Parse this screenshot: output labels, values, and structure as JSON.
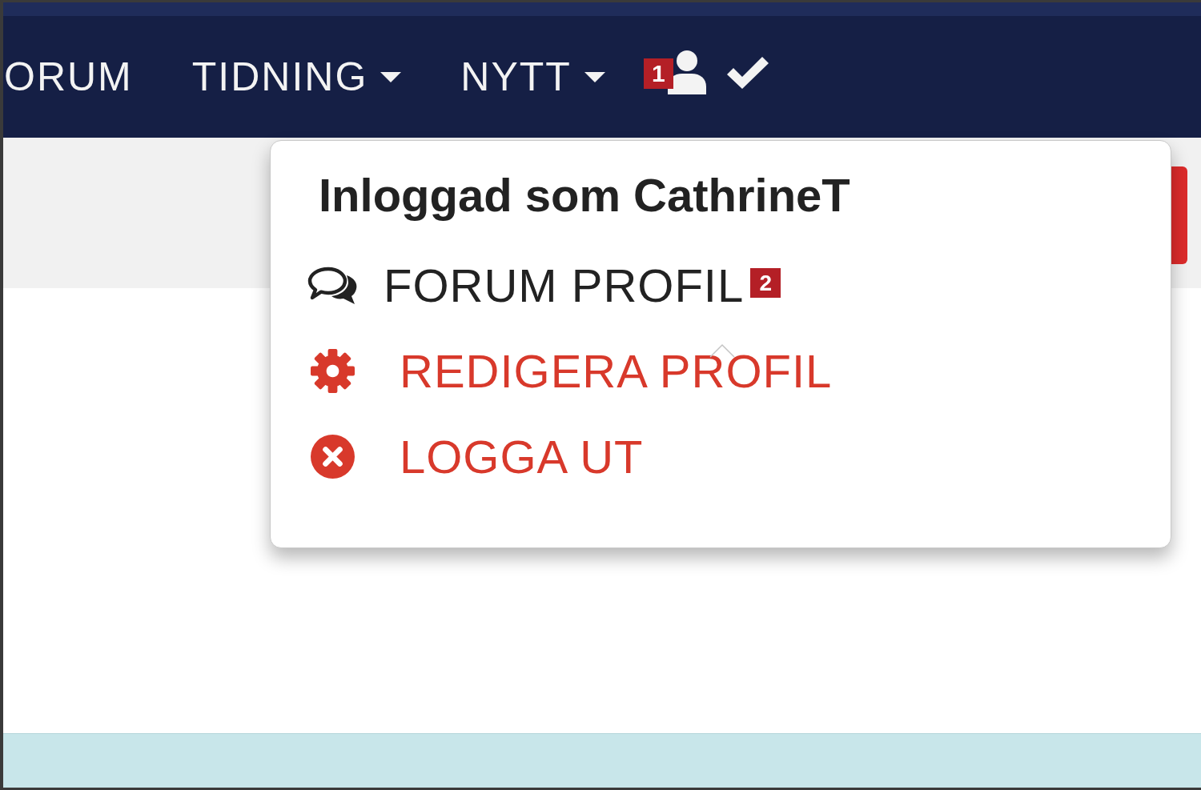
{
  "navbar": {
    "links": [
      {
        "label": "ORUM",
        "kind": "link"
      },
      {
        "label": "TIDNING",
        "kind": "dropdown"
      },
      {
        "label": "NYTT",
        "kind": "dropdown"
      }
    ],
    "actions": [
      {
        "kind": "user",
        "badge": "1",
        "expanded": true
      },
      {
        "kind": "check"
      }
    ]
  },
  "user_dropdown": {
    "heading": "Inloggad som CathrineT",
    "items": [
      {
        "label": "FORUM PROFIL",
        "kind": "forum",
        "badge": "2"
      },
      {
        "label": "REDIGERA PROFIL",
        "kind": "settings"
      },
      {
        "label": "LOGGA UT",
        "kind": "logout"
      }
    ]
  }
}
